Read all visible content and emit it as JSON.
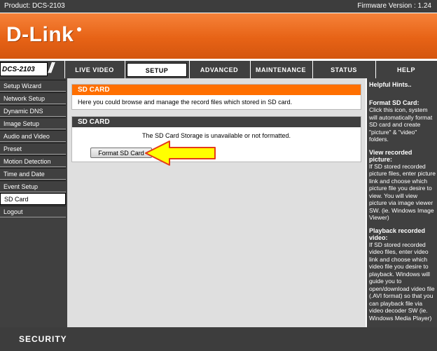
{
  "topbar": {
    "product": "Product: DCS-2103",
    "firmware": "Firmware Version : 1.24"
  },
  "brand": {
    "logo_text": "D-Link"
  },
  "nav": {
    "model": "DCS-2103",
    "tabs": [
      "LIVE VIDEO",
      "SETUP",
      "ADVANCED",
      "MAINTENANCE",
      "STATUS",
      "HELP"
    ],
    "active_tab": "SETUP"
  },
  "sidebar": {
    "items": [
      "Setup Wizard",
      "Network Setup",
      "Dynamic DNS",
      "Image Setup",
      "Audio and Video",
      "Preset",
      "Motion Detection",
      "Time and Date",
      "Event Setup",
      "SD Card",
      "Logout"
    ],
    "active": "SD Card"
  },
  "main": {
    "intro_title": "SD CARD",
    "intro_text": "Here you could browse and manage the record files which stored in SD card.",
    "section_title": "SD CARD",
    "status_text": "The SD Card Storage is unavailable or not formatted.",
    "format_button": "Format SD Card"
  },
  "hints": {
    "title": "Helpful Hints..",
    "sections": [
      {
        "heading": "Format SD Card:",
        "text": "Click this icon, system will automatically format SD card and create \"picture\" & \"video\" folders."
      },
      {
        "heading": "View recorded picture:",
        "text": "If SD stored recorded picture files, enter picture link and choose which picture file you desire to view. You will view picture via image viewer SW. (ie. Windows Image Viewer)"
      },
      {
        "heading": "Playback recorded video:",
        "text": "If SD stored recorded video files, enter video link and choose which video file you desire to playback. Windows will guide you to open/download video file (.AVI format) so that you can playback file via video decoder SW (ie. Windows Media Player)"
      }
    ]
  },
  "footer": {
    "label": "SECURITY"
  },
  "colors": {
    "accent": "#ff6f00",
    "dark": "#404040",
    "content_bg": "#dfdfdf",
    "arrow_fill": "#ffff00",
    "arrow_stroke": "#e53a1a"
  }
}
